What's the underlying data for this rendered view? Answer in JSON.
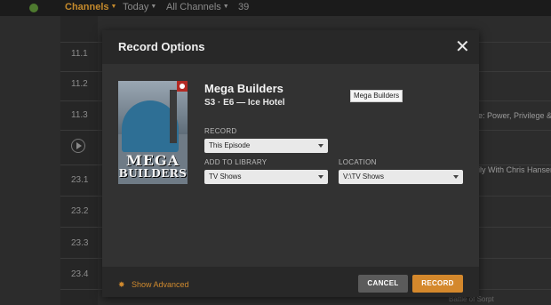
{
  "topbar": {
    "channels_label": "Channels",
    "today_label": "Today",
    "all_channels_label": "All Channels",
    "count": "39"
  },
  "guide": {
    "channels": [
      "11.1",
      "11.2",
      "11.3",
      "23.1",
      "23.2",
      "23.3",
      "23.4"
    ],
    "rail_texts": [
      "e: Power, Privilege & J",
      "ily With Chris Hansen"
    ],
    "rail_bottom": "Battle of Sorpt"
  },
  "modal": {
    "title": "Record Options",
    "show_title": "Mega Builders",
    "episode": "S3 · E6 — Ice Hotel",
    "tooltip": "Mega Builders",
    "poster_title_line1": "MEGA",
    "poster_title_line2": "BUILDERS",
    "record_label": "RECORD",
    "record_value": "This Episode",
    "library_label": "ADD TO LIBRARY",
    "library_value": "TV Shows",
    "location_label": "LOCATION",
    "location_value": "V:\\TV Shows",
    "show_advanced": "Show Advanced",
    "cancel": "CANCEL",
    "record_button": "RECORD",
    "close_symbol": "✕"
  },
  "colors": {
    "accent": "#d4882c",
    "modal_bg": "#323232",
    "header_bg": "#282828"
  }
}
